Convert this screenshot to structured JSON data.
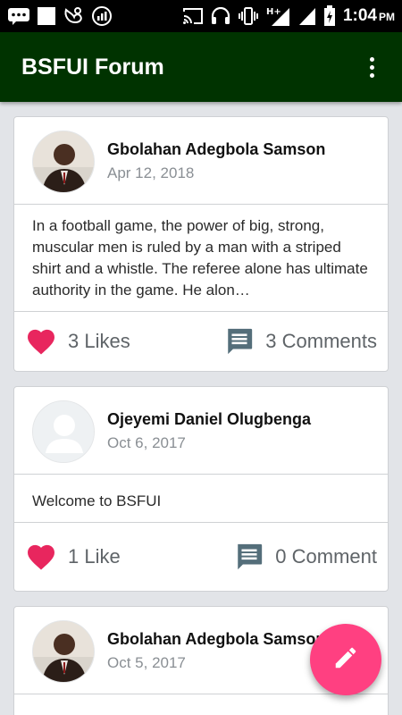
{
  "status_bar": {
    "time": "1:04",
    "ampm": "PM",
    "icons": [
      "chat-bubble-icon",
      "square-notification-icon",
      "uc-browser-icon",
      "data-speed-icon",
      "cast-icon",
      "headphones-icon",
      "vibrate-icon",
      "h-plus-signal-icon",
      "signal-bars-icon",
      "battery-icon"
    ]
  },
  "app_bar": {
    "title": "BSFUI Forum",
    "menu_icon": "more-vert-icon"
  },
  "posts": [
    {
      "author": "Gbolahan Adegbola Samson",
      "date": "Apr 12, 2018",
      "body": "In a football game, the power of big, strong, muscular men is ruled by a man with a striped shirt and a whistle. The referee alone has ultimate authority in the game. He alon…",
      "likes": "3 Likes",
      "comments": "3 Comments",
      "avatar": "photo"
    },
    {
      "author": "Ojeyemi Daniel Olugbenga",
      "date": "Oct 6, 2017",
      "body": "Welcome to BSFUI",
      "likes": "1 Like",
      "comments": "0 Comment",
      "avatar": "placeholder"
    },
    {
      "author": "Gbolahan Adegbola Samson",
      "date": "Oct 5, 2017",
      "avatar": "photo"
    }
  ],
  "fab": {
    "icon": "pencil-icon"
  },
  "colors": {
    "app_bar": "#003300",
    "heart": "#e8265e",
    "comment_icon": "#546e7a",
    "fab": "#ff4081"
  }
}
